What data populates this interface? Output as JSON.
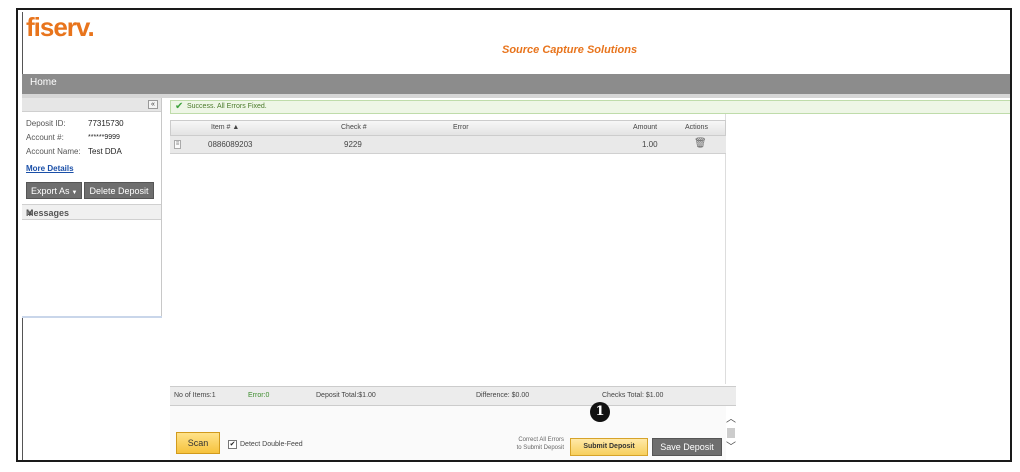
{
  "brand": {
    "logo": "fiserv.",
    "subtitle": "Source Capture Solutions",
    "accent": "#e8741c"
  },
  "nav": {
    "home": "Home"
  },
  "sidebar": {
    "collapse_glyph": "«",
    "deposit_id_label": "Deposit ID:",
    "deposit_id": "77315730",
    "account_label": "Account #:",
    "account": "******9999",
    "account_name_label": "Account Name:",
    "account_name": "Test DDA",
    "more_details": "More Details",
    "export_as": "Export As",
    "delete_deposit": "Delete Deposit",
    "messages": "Messages"
  },
  "status": {
    "message": "Success. All Errors Fixed.",
    "color": "#3fa33f"
  },
  "table": {
    "headers": [
      "Item # ▲",
      "Check #",
      "Error",
      "Amount",
      "Actions"
    ],
    "rows": [
      {
        "item": "0886089203",
        "check": "9229",
        "error": "",
        "amount": "1.00",
        "action_icon": "trash-icon"
      }
    ]
  },
  "summary": {
    "items": "No of Items:1",
    "errors": "Error:0",
    "deposit_total": "Deposit Total:$1.00",
    "difference": "Difference: $0.00",
    "checks_total": "Checks Total: $1.00"
  },
  "actions": {
    "scan": "Scan",
    "detect_double_feed": "Detect Double-Feed",
    "detect_checked": true,
    "correct_note_line1": "Correct All Errors",
    "correct_note_line2": "to Submit Deposit",
    "submit_deposit": "Submit Deposit",
    "save_deposit": "Save Deposit",
    "callout_number": "1"
  }
}
